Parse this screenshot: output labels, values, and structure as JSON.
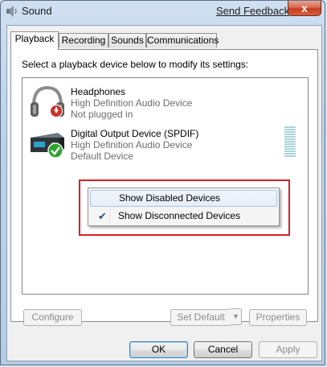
{
  "window": {
    "title": "Sound",
    "feedback_link": "Send Feedback",
    "close_glyph": "x"
  },
  "tabs": [
    {
      "label": "Playback",
      "active": true
    },
    {
      "label": "Recording",
      "active": false
    },
    {
      "label": "Sounds",
      "active": false
    },
    {
      "label": "Communications",
      "active": false
    }
  ],
  "playback": {
    "instructions": "Select a playback device below to modify its settings:",
    "devices": [
      {
        "name": "Headphones",
        "driver": "High Definition Audio Device",
        "status": "Not plugged in",
        "icon": "headphones-icon",
        "badge": "unplugged-down-arrow"
      },
      {
        "name": "Digital Output Device (SPDIF)",
        "driver": "High Definition Audio Device",
        "status": "Default Device",
        "icon": "spdif-receiver-icon",
        "badge": "default-green-check"
      }
    ]
  },
  "context_menu": {
    "items": [
      {
        "label": "Show Disabled Devices",
        "checked": false,
        "hover": true
      },
      {
        "label": "Show Disconnected Devices",
        "checked": true,
        "hover": false
      }
    ]
  },
  "buttons": {
    "configure": "Configure",
    "set_default": "Set Default",
    "properties": "Properties",
    "ok": "OK",
    "cancel": "Cancel",
    "apply": "Apply"
  },
  "colors": {
    "highlight_box": "#d61f26",
    "titlebar": "#bcd1e8",
    "close_button": "#c43c20"
  }
}
